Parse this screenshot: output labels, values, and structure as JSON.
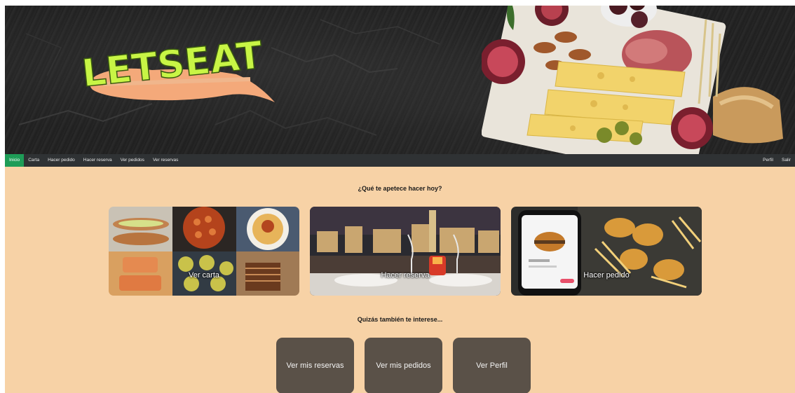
{
  "brand": {
    "logo_text": "LETSEAT"
  },
  "nav": {
    "items": [
      {
        "label": "Inicio",
        "active": true
      },
      {
        "label": "Carta"
      },
      {
        "label": "Hacer pedido"
      },
      {
        "label": "Hacer reserva"
      },
      {
        "label": "Ver pedidos"
      },
      {
        "label": "Ver reservas"
      }
    ],
    "right": [
      "Perfil",
      "Salir"
    ]
  },
  "main": {
    "question": "¿Qué te apetece hacer hoy?",
    "cards": [
      {
        "label": "Ver carta"
      },
      {
        "label": "Hacer reserva"
      },
      {
        "label": "Hacer pedido"
      }
    ],
    "suggest_title": "Quizás también te interese...",
    "buttons": [
      "Ver mis reservas",
      "Ver mis pedidos",
      "Ver Perfil"
    ]
  },
  "colors": {
    "page_bg": "#f7d2a6",
    "nav_bg": "#2f3234",
    "active": "#1e9c57",
    "button_bg": "#5a5148"
  }
}
